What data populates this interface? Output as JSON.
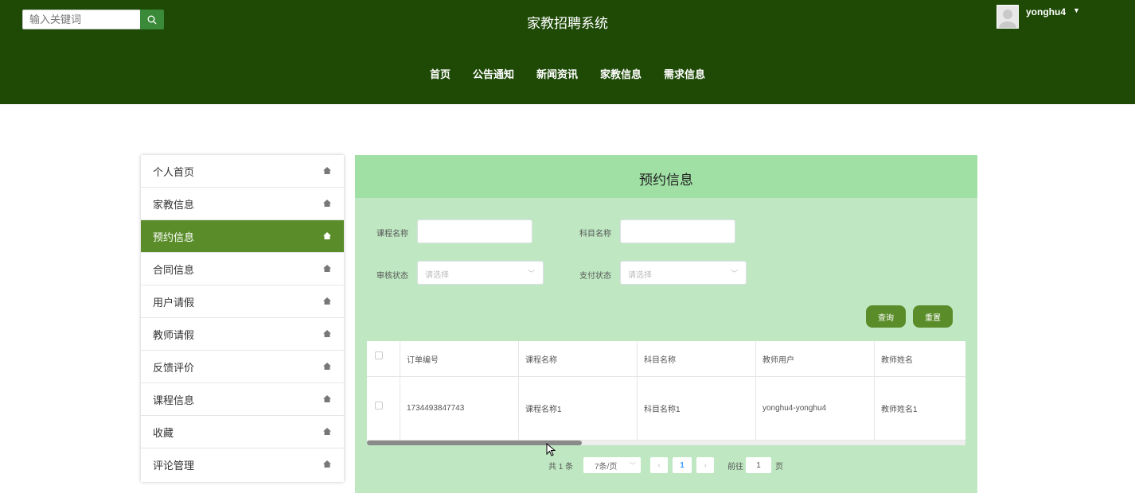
{
  "header": {
    "search_placeholder": "输入关键词",
    "title": "家教招聘系统",
    "username": "yonghu4",
    "nav": [
      "首页",
      "公告通知",
      "新闻资讯",
      "家教信息",
      "需求信息"
    ]
  },
  "sidebar": {
    "items": [
      {
        "label": "个人首页",
        "active": false
      },
      {
        "label": "家教信息",
        "active": false
      },
      {
        "label": "预约信息",
        "active": true
      },
      {
        "label": "合同信息",
        "active": false
      },
      {
        "label": "用户请假",
        "active": false
      },
      {
        "label": "教师请假",
        "active": false
      },
      {
        "label": "反馈评价",
        "active": false
      },
      {
        "label": "课程信息",
        "active": false
      },
      {
        "label": "收藏",
        "active": false
      },
      {
        "label": "评论管理",
        "active": false
      }
    ]
  },
  "main": {
    "title": "预约信息",
    "filters": {
      "course_label": "课程名称",
      "subject_label": "科目名称",
      "audit_label": "审核状态",
      "audit_placeholder": "请选择",
      "pay_label": "支付状态",
      "pay_placeholder": "请选择"
    },
    "buttons": {
      "query": "查询",
      "reset": "重置"
    },
    "table": {
      "headers": [
        "订单编号",
        "课程名称",
        "科目名称",
        "教师用户",
        "教师姓名"
      ],
      "rows": [
        [
          "1734493847743",
          "课程名称1",
          "科目名称1",
          "yonghu4-yonghu4",
          "教师姓名1"
        ]
      ]
    },
    "pagination": {
      "total": "共 1 条",
      "page_size": "7条/页",
      "current_page": "1",
      "goto_label": "前往",
      "goto_value": "1",
      "page_suffix": "页"
    }
  },
  "colors": {
    "header_bg": "#1e4a06",
    "accent": "#5a8d2a",
    "panel_bg": "#bfe8c2",
    "panel_head_bg": "#a0e0a4",
    "page_active": "#409eff"
  }
}
